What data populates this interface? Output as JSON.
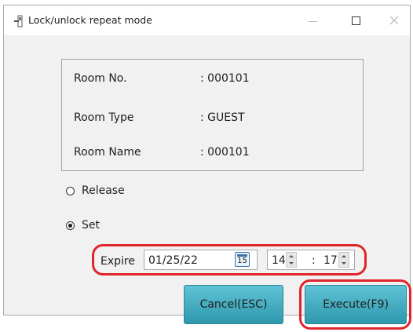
{
  "window": {
    "title": "Lock/unlock repeat mode",
    "icon": "door-lock-icon"
  },
  "room_info": {
    "rows": [
      {
        "label": "Room No.",
        "value": ": 000101"
      },
      {
        "label": "Room Type",
        "value": ": GUEST"
      },
      {
        "label": "Room Name",
        "value": ": 000101"
      }
    ]
  },
  "mode": {
    "options": [
      {
        "label": "Release",
        "checked": false
      },
      {
        "label": "Set",
        "checked": true
      }
    ]
  },
  "expire": {
    "label": "Expire",
    "date": "01/25/22",
    "calendar_icon_text": "15",
    "hour": "14",
    "separator": ":",
    "minute": "17"
  },
  "buttons": {
    "cancel": "Cancel(ESC)",
    "execute": "Execute(F9)"
  },
  "colors": {
    "button": "#3aaec2",
    "highlight": "#e0262b",
    "window_bg": "#f1f1f1"
  }
}
